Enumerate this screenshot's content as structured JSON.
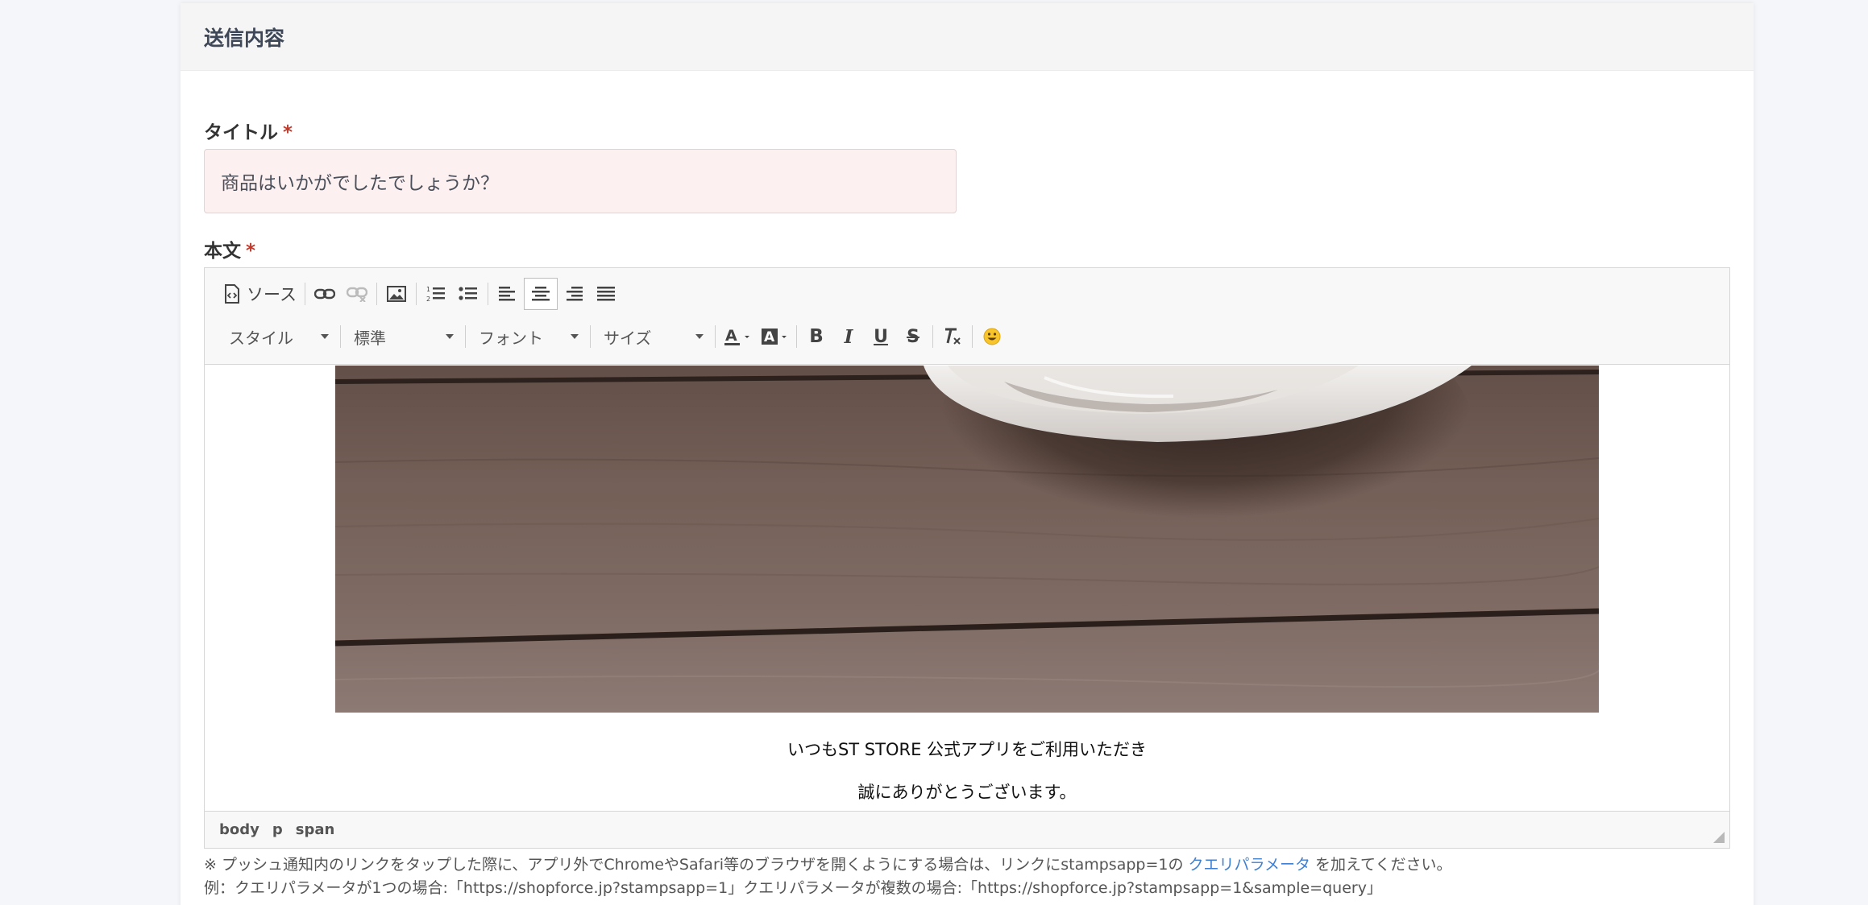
{
  "card": {
    "title": "送信内容"
  },
  "fields": {
    "title_label": "タイトル",
    "body_label": "本文",
    "required_mark": "*",
    "title_value": "商品はいかがでしたでしょうか？"
  },
  "toolbar": {
    "source_label": "ソース",
    "style_combo": "スタイル",
    "format_combo": "標準",
    "font_combo": "フォント",
    "size_combo": "サイズ",
    "bold": "B",
    "italic": "I",
    "underline": "U",
    "strike": "S"
  },
  "content": {
    "line1": "いつもST STORE 公式アプリをご利用いただき",
    "line2": "誠にありがとうございます。"
  },
  "statusbar": {
    "path": [
      "body",
      "p",
      "span"
    ]
  },
  "notes": {
    "line1_prefix": "※ プッシュ通知内のリンクをタップした際に、アプリ外でChromeやSafari等のブラウザを開くようにする場合は、リンクにstampsapp=1の",
    "line1_link": "クエリパラメータ",
    "line1_suffix": "を加えてください。",
    "line2": "例：クエリパラメータが1つの場合:「https://shopforce.jp?stampsapp=1」クエリパラメータが複数の場合:「https://shopforce.jp?stampsapp=1&sample=query」"
  },
  "colors": {
    "accent_link": "#3f7fd1",
    "required": "#c0392b",
    "title_bg": "#fdf0f1"
  }
}
